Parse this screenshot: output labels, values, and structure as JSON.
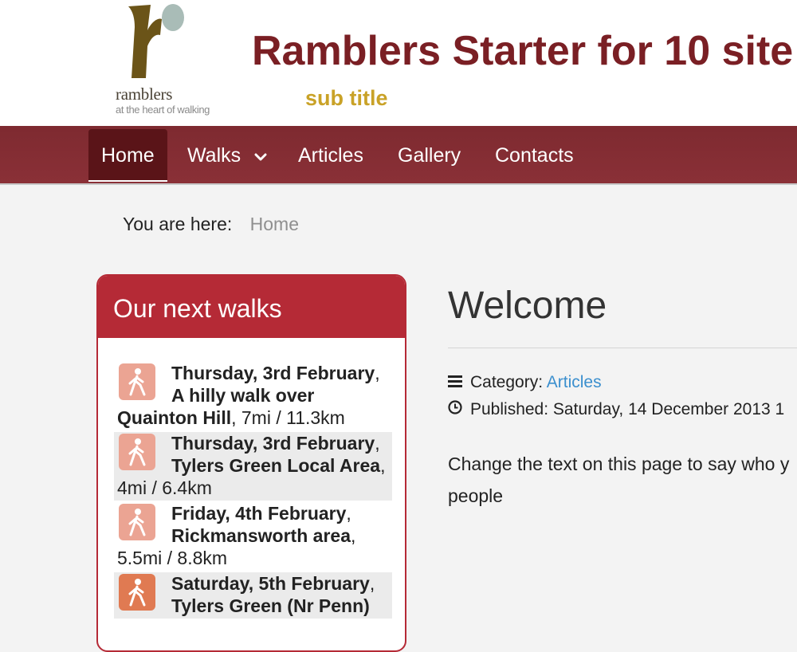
{
  "header": {
    "logo_word": "ramblers",
    "logo_tagline": "at the heart of walking",
    "title": "Ramblers Starter for 10 site",
    "subtitle": "sub title"
  },
  "nav": {
    "items": [
      {
        "label": "Home",
        "active": true
      },
      {
        "label": "Walks",
        "has_dropdown": true
      },
      {
        "label": "Articles"
      },
      {
        "label": "Gallery"
      },
      {
        "label": "Contacts"
      }
    ]
  },
  "breadcrumb": {
    "label": "You are here:",
    "current": "Home"
  },
  "walks": {
    "heading": "Our next walks",
    "items": [
      {
        "date": "Thursday, 3rd February",
        "title": "A hilly walk over Quainton Hill",
        "distance": ", 7mi / 11.3km"
      },
      {
        "date": "Thursday, 3rd February",
        "title": "Tylers Green Local Area",
        "distance": ", 4mi / 6.4km"
      },
      {
        "date": "Friday, 4th February",
        "title": "Rickmansworth area",
        "distance": ", 5.5mi / 8.8km"
      },
      {
        "date": "Saturday, 5th February",
        "title": "Tylers Green (Nr Penn)",
        "distance": ""
      }
    ]
  },
  "article": {
    "title": "Welcome",
    "category_label": "Category:",
    "category_value": "Articles",
    "published_label": "Published:",
    "published_value": "Saturday, 14 December 2013 1",
    "body_line1": "Change the text on this page to say who y",
    "body_line2": "people"
  },
  "colors": {
    "brand_maroon": "#7a1f24",
    "nav_red": "#8a3037",
    "panel_red": "#b52a36",
    "subtitle_gold": "#c9a227",
    "link_blue": "#3b8fce",
    "walk_icon_light": "#eba493",
    "walk_icon_strong": "#e07a52"
  }
}
